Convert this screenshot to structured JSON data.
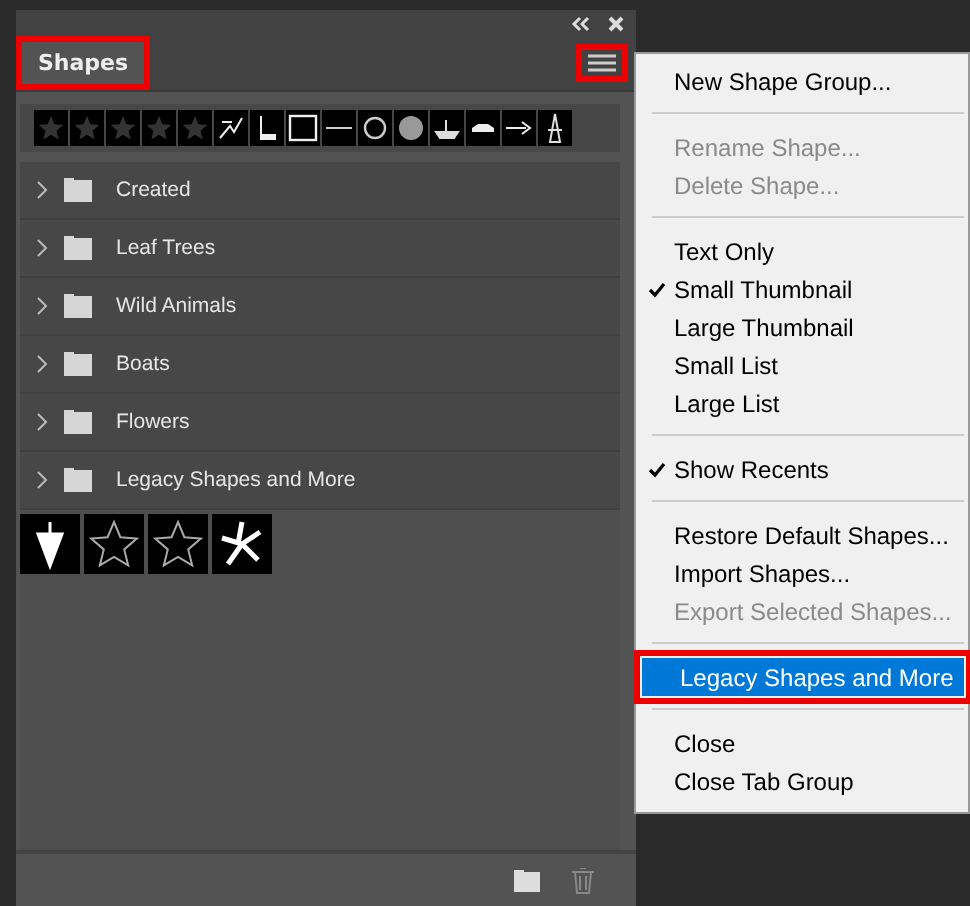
{
  "panel": {
    "tab": {
      "label": "Shapes",
      "selected": true,
      "annotated": true
    },
    "menu_button": {
      "annotated": true
    }
  },
  "groups": [
    {
      "label": "Created",
      "expanded": false
    },
    {
      "label": "Leaf Trees",
      "expanded": false
    },
    {
      "label": "Wild Animals",
      "expanded": false
    },
    {
      "label": "Boats",
      "expanded": false
    },
    {
      "label": "Flowers",
      "expanded": false
    },
    {
      "label": "Legacy Shapes and More",
      "expanded": false
    }
  ],
  "menu": [
    {
      "kind": "item",
      "label": "New Shape Group...",
      "disabled": false,
      "checked": false,
      "selected": false,
      "annotated": false
    },
    {
      "kind": "separator"
    },
    {
      "kind": "item",
      "label": "Rename Shape...",
      "disabled": true,
      "checked": false,
      "selected": false,
      "annotated": false
    },
    {
      "kind": "item",
      "label": "Delete Shape...",
      "disabled": true,
      "checked": false,
      "selected": false,
      "annotated": false
    },
    {
      "kind": "separator"
    },
    {
      "kind": "item",
      "label": "Text Only",
      "disabled": false,
      "checked": false,
      "selected": false,
      "annotated": false
    },
    {
      "kind": "item",
      "label": "Small Thumbnail",
      "disabled": false,
      "checked": true,
      "selected": false,
      "annotated": false
    },
    {
      "kind": "item",
      "label": "Large Thumbnail",
      "disabled": false,
      "checked": false,
      "selected": false,
      "annotated": false
    },
    {
      "kind": "item",
      "label": "Small List",
      "disabled": false,
      "checked": false,
      "selected": false,
      "annotated": false
    },
    {
      "kind": "item",
      "label": "Large List",
      "disabled": false,
      "checked": false,
      "selected": false,
      "annotated": false
    },
    {
      "kind": "separator"
    },
    {
      "kind": "item",
      "label": "Show Recents",
      "disabled": false,
      "checked": true,
      "selected": false,
      "annotated": false
    },
    {
      "kind": "separator"
    },
    {
      "kind": "item",
      "label": "Restore Default Shapes...",
      "disabled": false,
      "checked": false,
      "selected": false,
      "annotated": false
    },
    {
      "kind": "item",
      "label": "Import Shapes...",
      "disabled": false,
      "checked": false,
      "selected": false,
      "annotated": false
    },
    {
      "kind": "item",
      "label": "Export Selected Shapes...",
      "disabled": true,
      "checked": false,
      "selected": false,
      "annotated": false
    },
    {
      "kind": "separator"
    },
    {
      "kind": "item",
      "label": "Legacy Shapes and More",
      "disabled": false,
      "checked": false,
      "selected": true,
      "annotated": true
    },
    {
      "kind": "separator"
    },
    {
      "kind": "item",
      "label": "Close",
      "disabled": false,
      "checked": false,
      "selected": false,
      "annotated": false
    },
    {
      "kind": "item",
      "label": "Close Tab Group",
      "disabled": false,
      "checked": false,
      "selected": false,
      "annotated": false
    }
  ]
}
